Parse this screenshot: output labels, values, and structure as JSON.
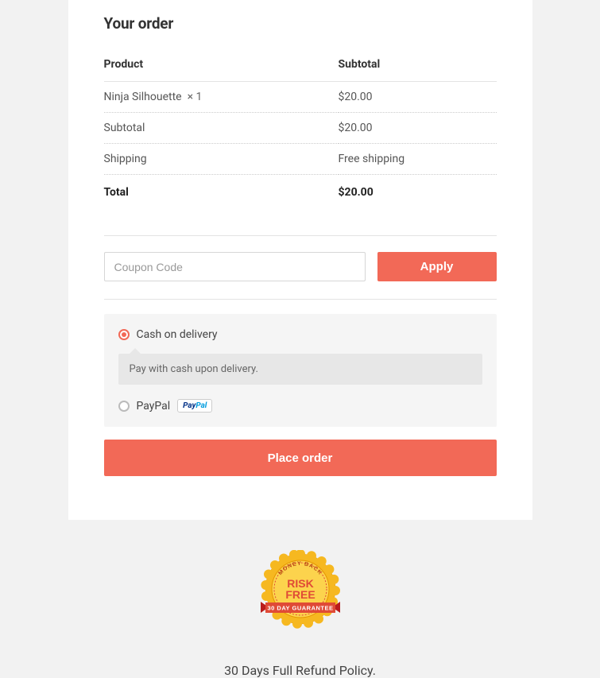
{
  "order": {
    "title": "Your order",
    "headers": {
      "product": "Product",
      "subtotal": "Subtotal"
    },
    "items": [
      {
        "name": "Ninja Silhouette",
        "qty": "× 1",
        "subtotal": "$20.00"
      }
    ],
    "summary": {
      "subtotal_label": "Subtotal",
      "subtotal_value": "$20.00",
      "shipping_label": "Shipping",
      "shipping_value": "Free shipping",
      "total_label": "Total",
      "total_value": "$20.00"
    }
  },
  "coupon": {
    "placeholder": "Coupon Code",
    "apply_label": "Apply"
  },
  "payment": {
    "cod": {
      "label": "Cash on delivery",
      "description": "Pay with cash upon delivery.",
      "selected": true
    },
    "paypal": {
      "label": "PayPal",
      "selected": false
    }
  },
  "place_order_label": "Place order",
  "guarantee": {
    "top_text": "MONEY BACK",
    "main_line1": "RISK",
    "main_line2": "FREE",
    "ribbon_text": "30 DAY GUARANTEE"
  },
  "refund_policy": "30 Days Full Refund Policy."
}
